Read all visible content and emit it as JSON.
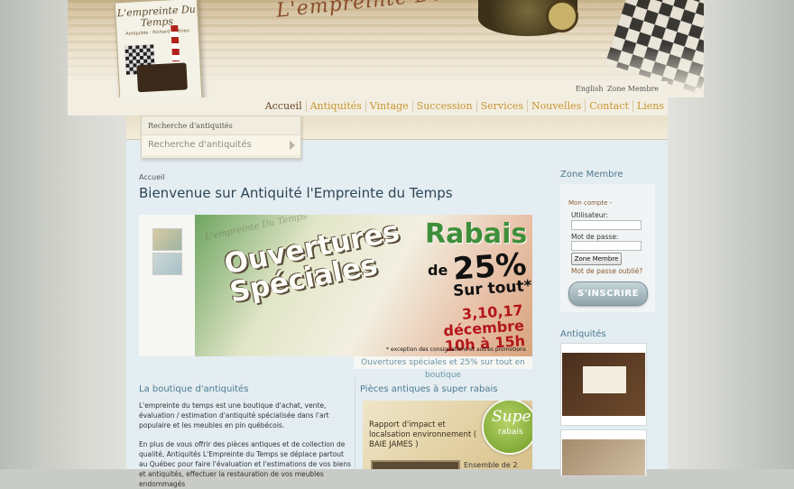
{
  "header": {
    "logo_text": "L'empreinte Du Temps",
    "book_title": "L'empreinte Du Temps",
    "book_subtitle": "Antiquités · Richard Mathieu"
  },
  "utility": {
    "english": "English",
    "member_zone": "Zone Membre"
  },
  "nav": [
    "Accueil",
    "Antiquités",
    "Vintage",
    "Succession",
    "Services",
    "Nouvelles",
    "Contact",
    "Liens"
  ],
  "search": {
    "label": "Recherche d'antiquités",
    "placeholder": "Recherche d'antiquités"
  },
  "breadcrumb": "Accueil",
  "page_title": "Bienvenue sur Antiquité l'Empreinte du Temps",
  "banner": {
    "headline_1": "Ouvertures",
    "headline_2": "Spéciales",
    "rabais": "Rabais",
    "de": "de",
    "percent": "25%",
    "sur_tout": "Sur tout*",
    "dates_1": "3,10,17 décembre",
    "dates_2": "10h à 15h",
    "footnote": "* exception des consignations et autres promotions",
    "caption": "Ouvertures spéciales et 25% sur tout en boutique"
  },
  "boutique": {
    "title": "La boutique d'antiquités",
    "para1": "L'empreinte du temps est une boutique d'achat, vente, évaluation / estimation  d'antiquité spécialisée dans l'art populaire et les meubles en pin québécois.",
    "para2": "En plus de vous offrir des pièces antiques et de collection de qualité, Antiquités L'Empreinte du Temps se déplace partout au Québec pour faire l'évaluation et l'estimations de vos biens et antiquités, effectuer la restauration de vos meubles endommagés"
  },
  "rabais_section": {
    "title": "Pièces antiques à super rabais",
    "promo_text": "Rapport d'impact et localsation environnement ( BAIE JAMES )",
    "badge_1": "Super",
    "badge_2": "rabais",
    "item_label": "Ensemble de 2"
  },
  "sidebar": {
    "member_title": "Zone Membre",
    "account_heading": "Mon compte -",
    "user_label": "Utilisateur:",
    "password_label": "Mot de passe:",
    "login_button": "Zone Membre",
    "forgot": "Mot de passe oublié?",
    "register": "S'INSCRIRE",
    "antiques_title": "Antiquités"
  }
}
